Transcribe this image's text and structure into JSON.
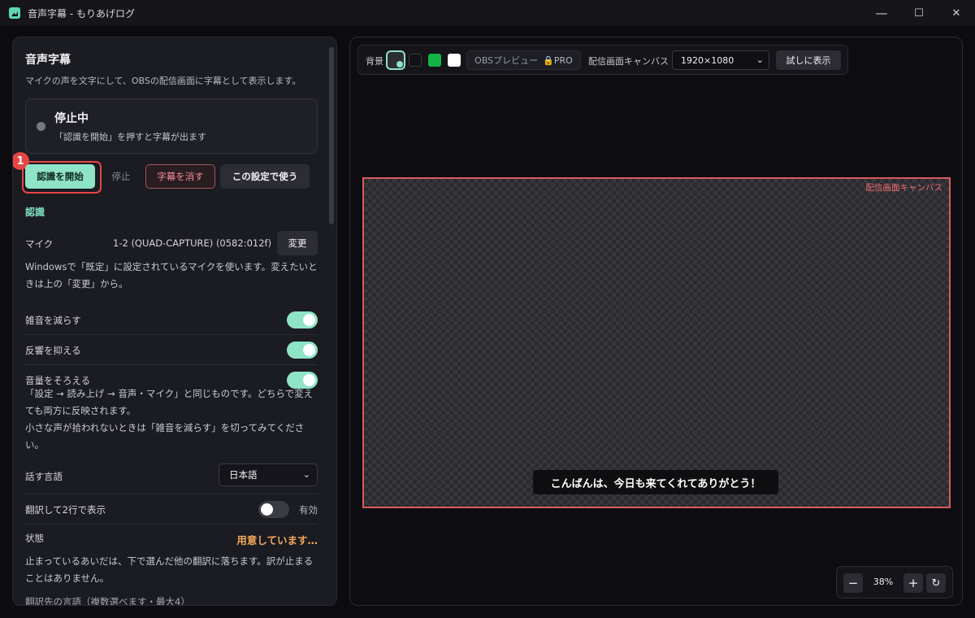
{
  "window": {
    "title": "音声字幕 - もりあげログ",
    "minimize": "—",
    "maximize": "☐",
    "close": "✕"
  },
  "left": {
    "title": "音声字幕",
    "subtitle": "マイクの声を文字にして、OBSの配信画面に字幕として表示します。",
    "status": {
      "title": "停止中",
      "hint": "「認識を開始」を押すと字幕が出ます"
    },
    "badge": "1",
    "buttons": {
      "start": "認識を開始",
      "stop": "停止",
      "clear": "字幕を消す",
      "use": "この設定で使う"
    },
    "section_recognition": "認識",
    "mic": {
      "label": "マイク",
      "value": "1-2 (QUAD-CAPTURE) (0582:012f)",
      "change": "変更"
    },
    "mic_note": "Windowsで「既定」に設定されているマイクを使います。変えたいときは上の「変更」から。",
    "toggles": [
      {
        "label": "雑音を減らす",
        "on": true
      },
      {
        "label": "反響を抑える",
        "on": true
      },
      {
        "label": "音量をそろえる",
        "on": true
      }
    ],
    "audio_note_1": "「設定 → 読み上げ → 音声・マイク」と同じものです。どちらで変えても両方に反映されます。",
    "audio_note_2": "小さな声が拾われないときは「雑音を減らす」を切ってみてください。",
    "language": {
      "label": "話す言語",
      "value": "日本語"
    },
    "translate": {
      "label": "翻訳して2行で表示",
      "on": false,
      "state": "有効"
    },
    "state": {
      "label": "状態",
      "value": "用意しています…"
    },
    "state_note": "止まっているあいだは、下で選んだ他の翻訳に落ちます。訳が止まることはありません。",
    "target_lang": "翻訳先の言語（複数選べます・最大4）"
  },
  "right": {
    "toolbar": {
      "bg_label": "背景",
      "swatch_colors": [
        "#111116",
        "#14b348",
        "#ffffff"
      ],
      "obs_preview": "OBSプレビュー",
      "pro": "🔒PRO",
      "canvas_label": "配信画面キャンバス",
      "resolution": "1920×1080",
      "try": "試しに表示"
    },
    "canvas": {
      "label": "配信画面キャンバス",
      "subtitle": "こんばんは、今日も来てくれてありがとう！"
    },
    "zoom": {
      "minus": "−",
      "value": "38%",
      "plus": "+",
      "reset": "↻"
    }
  },
  "colors": {
    "accent": "#8fe3c7",
    "danger": "#e64545",
    "warning": "#f2a85a"
  }
}
